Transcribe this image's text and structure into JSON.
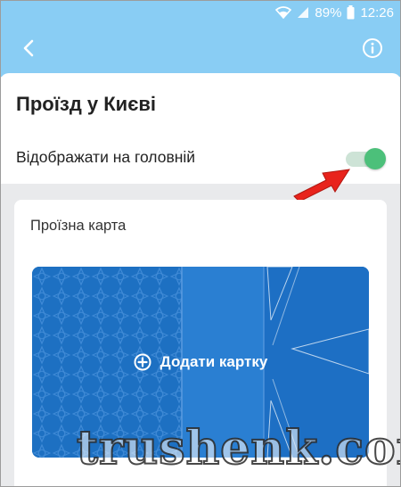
{
  "status_bar": {
    "battery": "89%",
    "time": "12:26",
    "icons": [
      "wifi-icon",
      "signal-icon",
      "battery-icon"
    ]
  },
  "header": {
    "back_icon": "chevron-left-icon",
    "info_icon": "info-circle-icon"
  },
  "page": {
    "title": "Проїзд у Києві",
    "show_on_main_label": "Відображати на головній",
    "show_on_main_enabled": true
  },
  "card_section": {
    "label": "Проїзна карта",
    "add_card_label": "Додати картку",
    "add_icon": "plus-circle-icon"
  },
  "watermark": "trushenk.com",
  "colors": {
    "header_bg": "#89cdf4",
    "toggle_on": "#4cc07a",
    "card_blue": "#1e74c8",
    "arrow_red": "#e8231c"
  }
}
